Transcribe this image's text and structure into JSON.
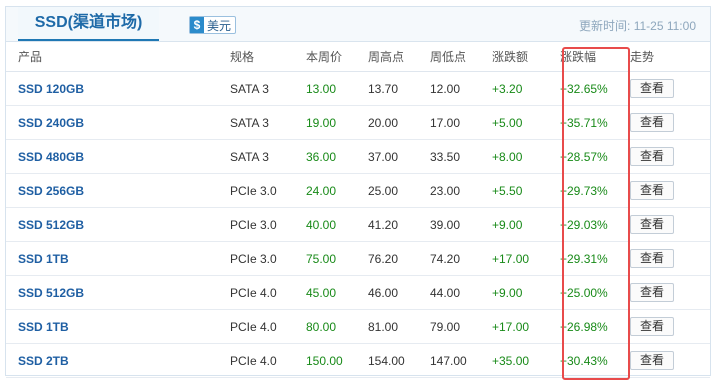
{
  "header": {
    "title": "SSD(渠道市场)",
    "currency_symbol": "$",
    "currency_label": "美元",
    "update_label": "更新时间:",
    "update_time": "11-25 11:00"
  },
  "columns": {
    "product": "产品",
    "spec": "规格",
    "current": "本周价",
    "high": "周高点",
    "low": "周低点",
    "change": "涨跌额",
    "pct": "涨跌幅",
    "trend": "走势"
  },
  "rows": [
    {
      "product": "SSD 120GB",
      "spec": "SATA 3",
      "current": "13.00",
      "high": "13.70",
      "low": "12.00",
      "change": "+3.20",
      "pct": "+32.65%",
      "action": "查看"
    },
    {
      "product": "SSD 240GB",
      "spec": "SATA 3",
      "current": "19.00",
      "high": "20.00",
      "low": "17.00",
      "change": "+5.00",
      "pct": "+35.71%",
      "action": "查看"
    },
    {
      "product": "SSD 480GB",
      "spec": "SATA 3",
      "current": "36.00",
      "high": "37.00",
      "low": "33.50",
      "change": "+8.00",
      "pct": "+28.57%",
      "action": "查看"
    },
    {
      "product": "SSD 256GB",
      "spec": "PCIe 3.0",
      "current": "24.00",
      "high": "25.00",
      "low": "23.00",
      "change": "+5.50",
      "pct": "+29.73%",
      "action": "查看"
    },
    {
      "product": "SSD 512GB",
      "spec": "PCIe 3.0",
      "current": "40.00",
      "high": "41.20",
      "low": "39.00",
      "change": "+9.00",
      "pct": "+29.03%",
      "action": "查看"
    },
    {
      "product": "SSD 1TB",
      "spec": "PCIe 3.0",
      "current": "75.00",
      "high": "76.20",
      "low": "74.20",
      "change": "+17.00",
      "pct": "+29.31%",
      "action": "查看"
    },
    {
      "product": "SSD 512GB",
      "spec": "PCIe 4.0",
      "current": "45.00",
      "high": "46.00",
      "low": "44.00",
      "change": "+9.00",
      "pct": "+25.00%",
      "action": "查看"
    },
    {
      "product": "SSD 1TB",
      "spec": "PCIe 4.0",
      "current": "80.00",
      "high": "81.00",
      "low": "79.00",
      "change": "+17.00",
      "pct": "+26.98%",
      "action": "查看"
    },
    {
      "product": "SSD 2TB",
      "spec": "PCIe 4.0",
      "current": "150.00",
      "high": "154.00",
      "low": "147.00",
      "change": "+35.00",
      "pct": "+30.43%",
      "action": "查看"
    }
  ],
  "colors": {
    "title_text": "#1e6aa8",
    "title_underline": "#1f78b4",
    "product_link": "#1f5fa3",
    "price_up": "#188a18",
    "highlight_border": "#e84b4b"
  }
}
